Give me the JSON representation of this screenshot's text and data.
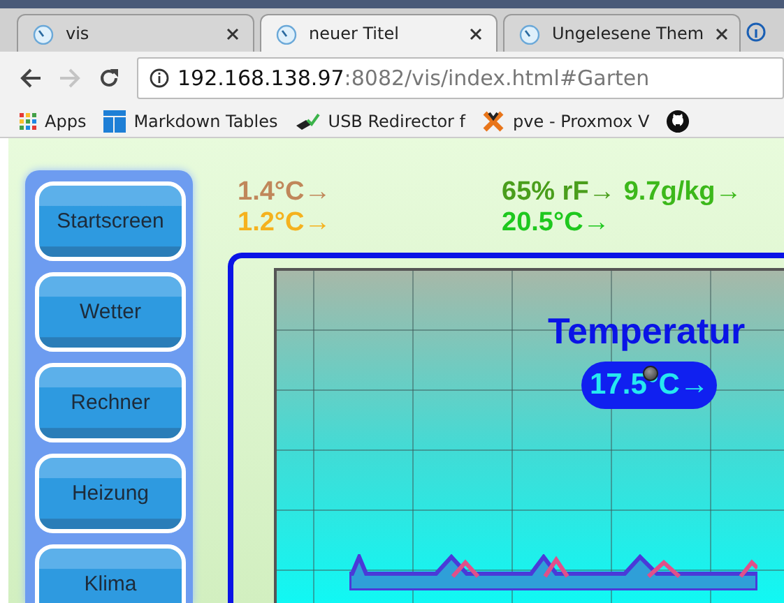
{
  "browser": {
    "tabs": [
      {
        "title": "vis",
        "selected": false
      },
      {
        "title": "neuer Titel",
        "selected": true
      },
      {
        "title": "Ungelesene Them",
        "selected": false
      }
    ],
    "address": {
      "host": "192.168.138.97",
      "path": ":8082/vis/index.html#Garten"
    },
    "forward_disabled": true,
    "bookmarks": [
      {
        "kind": "apps",
        "label": "Apps"
      },
      {
        "kind": "tables",
        "label": "Markdown Tables"
      },
      {
        "kind": "usb",
        "label": "USB Redirector f"
      },
      {
        "kind": "proxmox",
        "label": "pve - Proxmox V"
      },
      {
        "kind": "github"
      }
    ]
  },
  "nav": [
    {
      "label": "Startscreen"
    },
    {
      "label": "Wetter"
    },
    {
      "label": "Rechner"
    },
    {
      "label": "Heizung"
    },
    {
      "label": "Klima"
    }
  ],
  "outdoor_readings": [
    {
      "text": "1.4°C→",
      "color": "#c0875a"
    },
    {
      "text": "1.2°C→",
      "color": "#f5b21e"
    }
  ],
  "climate_readings": [
    {
      "text": "65% rF→",
      "color": "#4a9e1c"
    },
    {
      "text": "9.7g/kg→",
      "color": "#3cb81a"
    },
    {
      "text": "20.5°C→",
      "color": "#1ec81e"
    }
  ],
  "chart_panel": {
    "title": "Temperatur",
    "value": "17.5°C→"
  }
}
